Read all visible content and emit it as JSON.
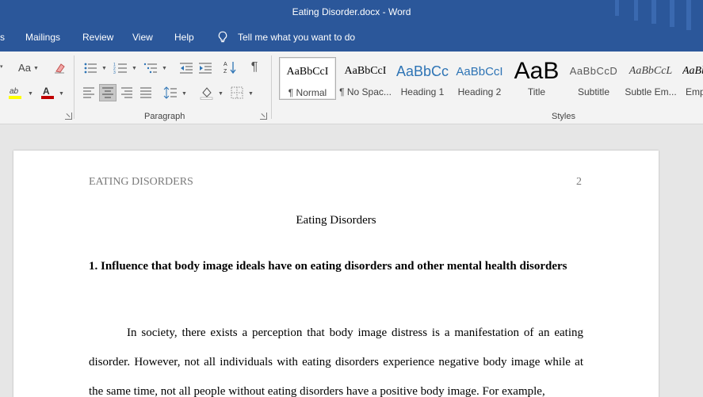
{
  "window": {
    "title": "Eating Disorder.docx  -  Word"
  },
  "ribbon_tabs": [
    {
      "label": "s"
    },
    {
      "label": "Mailings"
    },
    {
      "label": "Review"
    },
    {
      "label": "View"
    },
    {
      "label": "Help"
    }
  ],
  "tell_me": {
    "label": "Tell me what you want to do",
    "icon": "lightbulb-icon"
  },
  "font_group": {
    "change_case_label": "Aa",
    "font_color": "#c00000",
    "highlight_color": "#ffff00"
  },
  "paragraph_group": {
    "label": "Paragraph"
  },
  "styles_group": {
    "label": "Styles",
    "items": [
      {
        "sample": "AaBbCcI",
        "name": "¶ Normal",
        "selected": true
      },
      {
        "sample": "AaBbCcI",
        "name": "¶ No Spac..."
      },
      {
        "sample": "AaBbCc",
        "name": "Heading 1"
      },
      {
        "sample": "AaBbCcI",
        "name": "Heading 2"
      },
      {
        "sample": "AaB",
        "name": "Title"
      },
      {
        "sample": "AaBbCcD",
        "name": "Subtitle"
      },
      {
        "sample": "AaBbCcL",
        "name": "Subtle Em..."
      },
      {
        "sample": "AaBb",
        "name": "Emp"
      }
    ]
  },
  "document": {
    "header_text": "EATING DISORDERS",
    "page_number": "2",
    "title": "Eating Disorders",
    "heading": "1. Influence that body image ideals have on eating disorders and other mental health disorders",
    "paragraph": "In society, there exists a perception that body image distress is a manifestation of an eating disorder. However, not all individuals with eating disorders experience negative body image while at the same time, not all people without eating disorders have a positive body image. For example,"
  },
  "colors": {
    "title_bar": "#2b579a",
    "ribbon": "#f3f3f3",
    "canvas": "#e6e6e6",
    "heading1": "#2e74b5",
    "heading2": "#2e74b5"
  }
}
